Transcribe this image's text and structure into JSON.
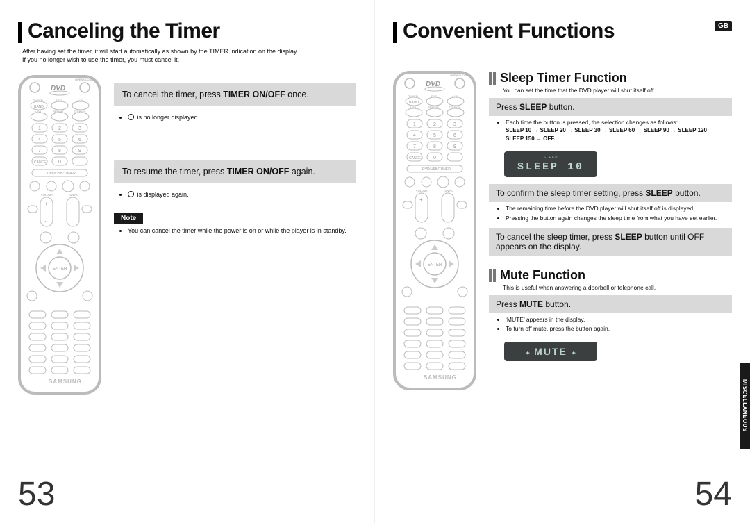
{
  "lang_badge": "GB",
  "left": {
    "title": "Canceling the Timer",
    "intro_l1": "After having set the timer, it will start automatically as shown by the TIMER indication on the display.",
    "intro_l2": "If you no longer wish to use the timer, you must cancel it.",
    "step1": "To cancel the timer, press TIMER ON/OFF once.",
    "step1_bullet": "is no longer displayed.",
    "step2": "To resume the timer, press TIMER ON/OFF again.",
    "step2_bullet": "is displayed again.",
    "note_label": "Note",
    "note_text": "You can cancel the timer while the power is on or while the player is in standby.",
    "page_num": "53"
  },
  "right": {
    "title": "Convenient Functions",
    "sleep_head": "Sleep Timer Function",
    "sleep_intro": "You can set the time that the DVD player will shut itself off.",
    "sleep_step1": "Press SLEEP button.",
    "sleep_step1_b1": "Each time the button is pressed, the selection changes as follows:",
    "sleep_seq": "SLEEP 10 → SLEEP 20 → SLEEP 30 → SLEEP 60 → SLEEP 90 → SLEEP 120 → SLEEP 150 → OFF.",
    "sleep_display_label": "SLEEP",
    "sleep_display": "SLEEP 10",
    "sleep_step2": "To confirm the sleep timer setting, press SLEEP button.",
    "sleep_step2_b1": "The remaining time before the DVD player will shut itself off is displayed.",
    "sleep_step2_b2": "Pressing the button again changes the sleep time from what you have set earlier.",
    "sleep_step3": "To cancel the sleep timer, press SLEEP button until OFF appears on the display.",
    "mute_head": "Mute Function",
    "mute_intro": "This is useful when answering a doorbell or telephone call.",
    "mute_step1": "Press MUTE button.",
    "mute_b1": "‘MUTE’ appears in the display.",
    "mute_b2": "To turn off mute, press the button again.",
    "mute_display": "MUTE",
    "side_tab": "MISCELLANEOUS",
    "page_num": "54"
  },
  "remote_text": {
    "dvd": "DVD",
    "openclose": "OPEN/CLOSE",
    "tuner": "TUNER",
    "dvd_btn": "DVD",
    "aux": "AUX",
    "band": "BAND",
    "usb": "USB",
    "repeat": "REPEAT",
    "stepch": "STEP/CH",
    "cancel": "CANCEL",
    "dvdusbtuner": "DVD/USB/TUNER",
    "enter": "ENTER",
    "samsung": "SAMSUNG"
  }
}
